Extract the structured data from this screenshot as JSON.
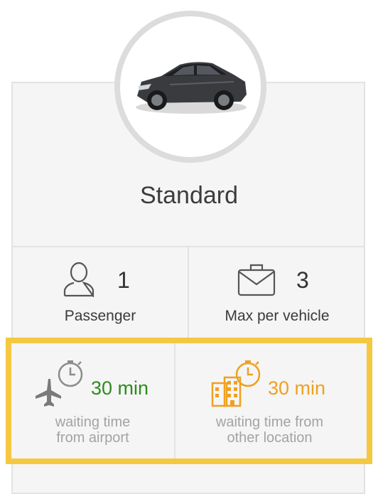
{
  "vehicle": {
    "class_name": "Standard"
  },
  "stats": {
    "passengers": {
      "value": "1",
      "label": "Passenger",
      "icon": "person-icon"
    },
    "luggage": {
      "value": "3",
      "label": "Max per vehicle",
      "icon": "briefcase-icon"
    }
  },
  "waiting": {
    "airport": {
      "value": "30 min",
      "label": "waiting time from airport",
      "line1": "waiting time",
      "line2": "from airport",
      "icon": "airplane-timer-icon",
      "color": "#2e8b1e"
    },
    "other": {
      "value": "30 min",
      "label": "waiting time from other location",
      "line1": "waiting time from",
      "line2": "other location",
      "icon": "building-timer-icon",
      "color": "#f0a020"
    }
  },
  "colors": {
    "highlight_border": "#f5c842",
    "card_bg": "#f5f5f5"
  }
}
